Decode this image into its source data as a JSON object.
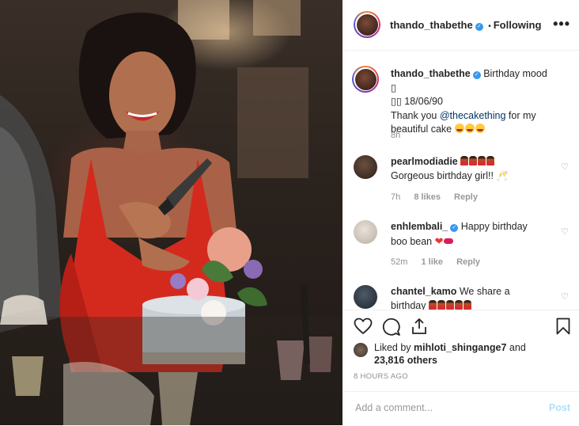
{
  "post": {
    "username": "thando_thabethe",
    "follow_sep": "•",
    "follow_label": "Following",
    "more_label": "•••"
  },
  "caption": {
    "username": "thando_thabethe",
    "text_line1": "Birthday mood",
    "glyph1": "▯",
    "glyph2": "▯▯",
    "date": "18/06/90",
    "thank_you": "Thank you",
    "mention": "@thecakething",
    "for_my": "for my beautiful cake",
    "time": "8h"
  },
  "comments": [
    {
      "username": "pearlmodiadie",
      "text": "Gorgeous birthday girl!!",
      "time": "7h",
      "likes": "8 likes",
      "reply": "Reply"
    },
    {
      "username": "enhlembali_",
      "text_a": "Happy birthday",
      "text_b": "boo bean",
      "time": "52m",
      "likes": "1 like",
      "reply": "Reply"
    },
    {
      "username": "chantel_kamo",
      "text_a": "We share a",
      "text_b": "birthday"
    }
  ],
  "likes": {
    "prefix": "Liked by",
    "user": "mihloti_shingange7",
    "and": "and",
    "others": "23,816 others"
  },
  "timestamp": "8 HOURS AGO",
  "add_comment": {
    "placeholder": "Add a comment...",
    "post_label": "Post"
  },
  "icons": {
    "verified": "verified-badge-icon",
    "like": "heart-outline-icon",
    "comment": "speech-bubble-icon",
    "share": "share-upload-icon",
    "save": "bookmark-icon"
  },
  "colors": {
    "link": "#003569",
    "verified": "#3897f0",
    "post_disabled": "#b2dffc",
    "muted": "#8e8e8e"
  }
}
